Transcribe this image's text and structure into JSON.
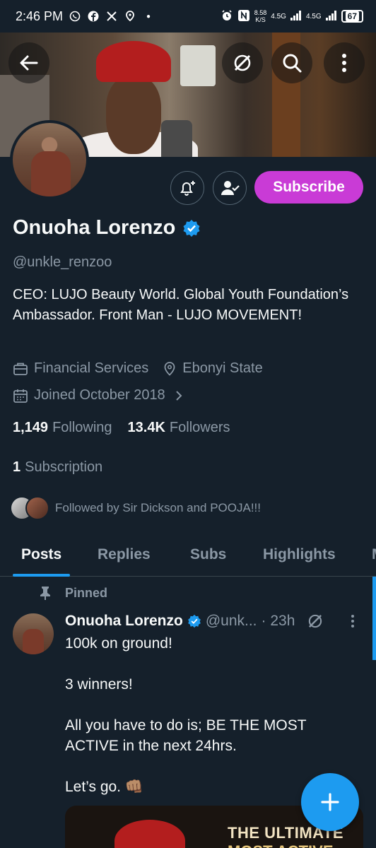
{
  "status_bar": {
    "time": "2:46 PM",
    "speed_value": "8.58",
    "speed_unit": "K/S",
    "network1": "4.5G",
    "network2": "4.5G",
    "battery": "67"
  },
  "profile": {
    "name": "Onuoha Lorenzo",
    "handle": "@unkle_renzoo",
    "bio": "CEO: LUJO Beauty World. Global Youth Foundation’s Ambassador. Front Man - LUJO MOVEMENT!",
    "category": "Financial Services",
    "location": "Ebonyi State",
    "joined": "Joined October 2018",
    "following_count": "1,149",
    "following_label": "Following",
    "followers_count": "13.4K",
    "followers_label": "Followers",
    "subscription_count": "1",
    "subscription_label": "Subscription",
    "followed_by": "Followed by Sir Dickson and POOJA!!!",
    "subscribe_label": "Subscribe"
  },
  "tabs": [
    "Posts",
    "Replies",
    "Subs",
    "Highlights",
    "M"
  ],
  "post": {
    "pinned_label": "Pinned",
    "author": "Onuoha Lorenzo",
    "handle_truncated": "@unk...",
    "time": "· 23h",
    "line1": "100k on ground!",
    "line2": "3 winners!",
    "line3": "All you have to do is; BE THE MOST ACTIVE in the next 24hrs.",
    "line4": "Let’s go. 👊🏽",
    "media_title": "THE ULTIMATE",
    "media_subtitle": "MOST ACTIVE"
  },
  "colors": {
    "background": "#15202b",
    "accent": "#1d9bf0",
    "subscribe": "#c93bd6",
    "muted": "#8b98a5"
  }
}
